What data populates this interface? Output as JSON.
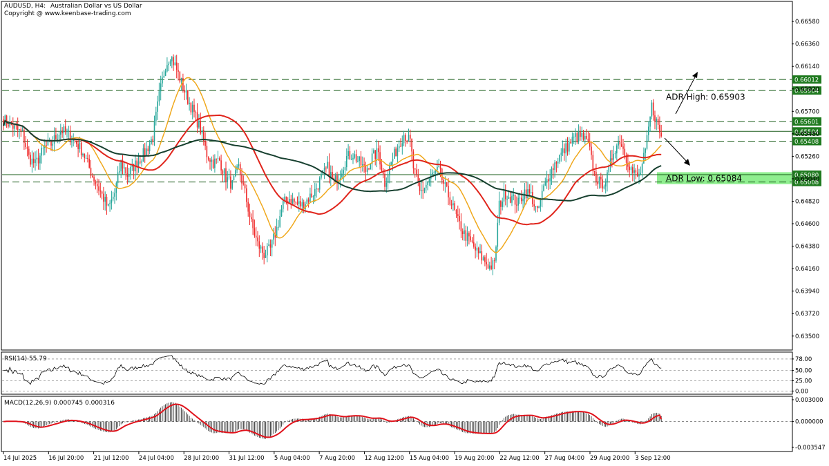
{
  "header": {
    "symbol": "AUDUSD, H4:",
    "description": "Australian Dollar vs US Dollar",
    "copyright": "Copyright @ www.keenbase-trading.com"
  },
  "colors": {
    "bull": "#26a69a",
    "bear": "#ef2b2b",
    "ma_fast": "#f0a81c",
    "ma_mid": "#e0241b",
    "ma_slow": "#17402f",
    "level_tag": "#1f7a1f",
    "adr_zone": "#8fee8f",
    "macd_signal": "#e0121b",
    "grid_dash": "#1a5c1a"
  },
  "chart_data": [
    {
      "type": "candlestick",
      "title": "AUDUSD, H4:  Australian Dollar vs US Dollar",
      "y_axis_ticks": [
        "0.66580",
        "0.66360",
        "0.66140",
        "0.65920",
        "0.65700",
        "0.65480",
        "0.65260",
        "0.65040",
        "0.64820",
        "0.64600",
        "0.64380",
        "0.64160",
        "0.63940",
        "0.63720",
        "0.63500"
      ],
      "x_axis_ticks": [
        "14 Jul 2025",
        "16 Jul 20:00",
        "21 Jul 12:00",
        "24 Jul 04:00",
        "28 Jul 20:00",
        "31 Jul 12:00",
        "5 Aug 04:00",
        "7 Aug 20:00",
        "12 Aug 12:00",
        "15 Aug 04:00",
        "19 Aug 20:00",
        "22 Aug 12:00",
        "27 Aug 04:00",
        "29 Aug 20:00",
        "3 Sep 12:00"
      ],
      "ylim": [
        0.6337,
        0.6677
      ],
      "close_path": [
        [
          0,
          0.6562
        ],
        [
          6,
          0.6555
        ],
        [
          12,
          0.6548
        ],
        [
          16,
          0.6525
        ],
        [
          20,
          0.6518
        ],
        [
          26,
          0.6535
        ],
        [
          30,
          0.6538
        ],
        [
          36,
          0.6552
        ],
        [
          40,
          0.6548
        ],
        [
          46,
          0.6539
        ],
        [
          50,
          0.653
        ],
        [
          56,
          0.6507
        ],
        [
          62,
          0.6488
        ],
        [
          66,
          0.6475
        ],
        [
          70,
          0.649
        ],
        [
          74,
          0.652
        ],
        [
          78,
          0.6508
        ],
        [
          84,
          0.652
        ],
        [
          90,
          0.6532
        ],
        [
          94,
          0.6545
        ],
        [
          98,
          0.6585
        ],
        [
          102,
          0.6615
        ],
        [
          105,
          0.6625
        ],
        [
          108,
          0.6615
        ],
        [
          112,
          0.6598
        ],
        [
          116,
          0.6582
        ],
        [
          120,
          0.6568
        ],
        [
          124,
          0.6552
        ],
        [
          128,
          0.6528
        ],
        [
          132,
          0.652
        ],
        [
          136,
          0.6522
        ],
        [
          140,
          0.6505
        ],
        [
          144,
          0.6498
        ],
        [
          148,
          0.6515
        ],
        [
          152,
          0.649
        ],
        [
          156,
          0.646
        ],
        [
          160,
          0.644
        ],
        [
          164,
          0.643
        ],
        [
          168,
          0.6435
        ],
        [
          172,
          0.6455
        ],
        [
          176,
          0.648
        ],
        [
          180,
          0.6485
        ],
        [
          184,
          0.648
        ],
        [
          188,
          0.6478
        ],
        [
          192,
          0.6485
        ],
        [
          196,
          0.6492
        ],
        [
          200,
          0.6505
        ],
        [
          204,
          0.6515
        ],
        [
          208,
          0.65
        ],
        [
          212,
          0.651
        ],
        [
          216,
          0.6525
        ],
        [
          220,
          0.6528
        ],
        [
          224,
          0.652
        ],
        [
          228,
          0.6512
        ],
        [
          232,
          0.6525
        ],
        [
          236,
          0.653
        ],
        [
          240,
          0.65
        ],
        [
          244,
          0.652
        ],
        [
          248,
          0.6535
        ],
        [
          252,
          0.6548
        ],
        [
          256,
          0.654
        ],
        [
          258,
          0.6515
        ],
        [
          262,
          0.649
        ],
        [
          266,
          0.6498
        ],
        [
          270,
          0.6508
        ],
        [
          274,
          0.6512
        ],
        [
          278,
          0.6495
        ],
        [
          282,
          0.648
        ],
        [
          286,
          0.6462
        ],
        [
          290,
          0.645
        ],
        [
          294,
          0.6442
        ],
        [
          298,
          0.6432
        ],
        [
          302,
          0.6425
        ],
        [
          306,
          0.6418
        ],
        [
          309,
          0.642
        ],
        [
          312,
          0.6478
        ],
        [
          316,
          0.649
        ],
        [
          320,
          0.6485
        ],
        [
          324,
          0.648
        ],
        [
          328,
          0.6492
        ],
        [
          332,
          0.6488
        ],
        [
          336,
          0.647
        ],
        [
          340,
          0.6495
        ],
        [
          344,
          0.651
        ],
        [
          348,
          0.6522
        ],
        [
          352,
          0.653
        ],
        [
          356,
          0.6538
        ],
        [
          360,
          0.6545
        ],
        [
          364,
          0.6545
        ],
        [
          368,
          0.6538
        ],
        [
          372,
          0.6508
        ],
        [
          376,
          0.6498
        ],
        [
          380,
          0.6505
        ],
        [
          384,
          0.6532
        ],
        [
          388,
          0.6542
        ],
        [
          392,
          0.6525
        ],
        [
          396,
          0.651
        ],
        [
          400,
          0.6505
        ],
        [
          404,
          0.653
        ],
        [
          408,
          0.6575
        ],
        [
          411,
          0.656
        ],
        [
          414,
          0.6545
        ]
      ],
      "price_levels": [
        {
          "label": "0.66012",
          "value": 0.66012,
          "style": "dashed"
        },
        {
          "label": "0.65904",
          "value": 0.65904,
          "style": "dashed"
        },
        {
          "label": "0.65601",
          "value": 0.65601,
          "style": "dashed"
        },
        {
          "label": "0.65504",
          "value": 0.65504,
          "style": "solid"
        },
        {
          "label": "0.65408",
          "value": 0.65408,
          "style": "dashed"
        },
        {
          "label": "0.65080",
          "value": 0.6508,
          "style": "solid"
        },
        {
          "label": "0.65008",
          "value": 0.65008,
          "style": "dashed"
        }
      ],
      "adr_zone": [
        0.65008,
        0.65084
      ],
      "annotations": [
        {
          "text": "ADR High: 0.65903",
          "value": 0.65903
        },
        {
          "text": "ADR Low: 0.65084",
          "value": 0.65084
        }
      ]
    },
    {
      "type": "line",
      "title": "RSI(14) 55.79",
      "y_axis_ticks": [
        "78.00",
        "50.00",
        "25.00",
        "0.00"
      ],
      "levels": [
        78,
        50,
        25,
        0
      ],
      "ylim": [
        -6,
        93
      ],
      "current": 55.79
    },
    {
      "type": "histogram+line",
      "title": "MACD(12,26,9) 0.000745 0.000316",
      "y_axis_ticks": [
        "0.003000",
        "0.000000",
        "-0.003547"
      ],
      "ylim": [
        -0.003547,
        0.003
      ],
      "current_macd": 0.000745,
      "current_signal": 0.000316
    }
  ]
}
